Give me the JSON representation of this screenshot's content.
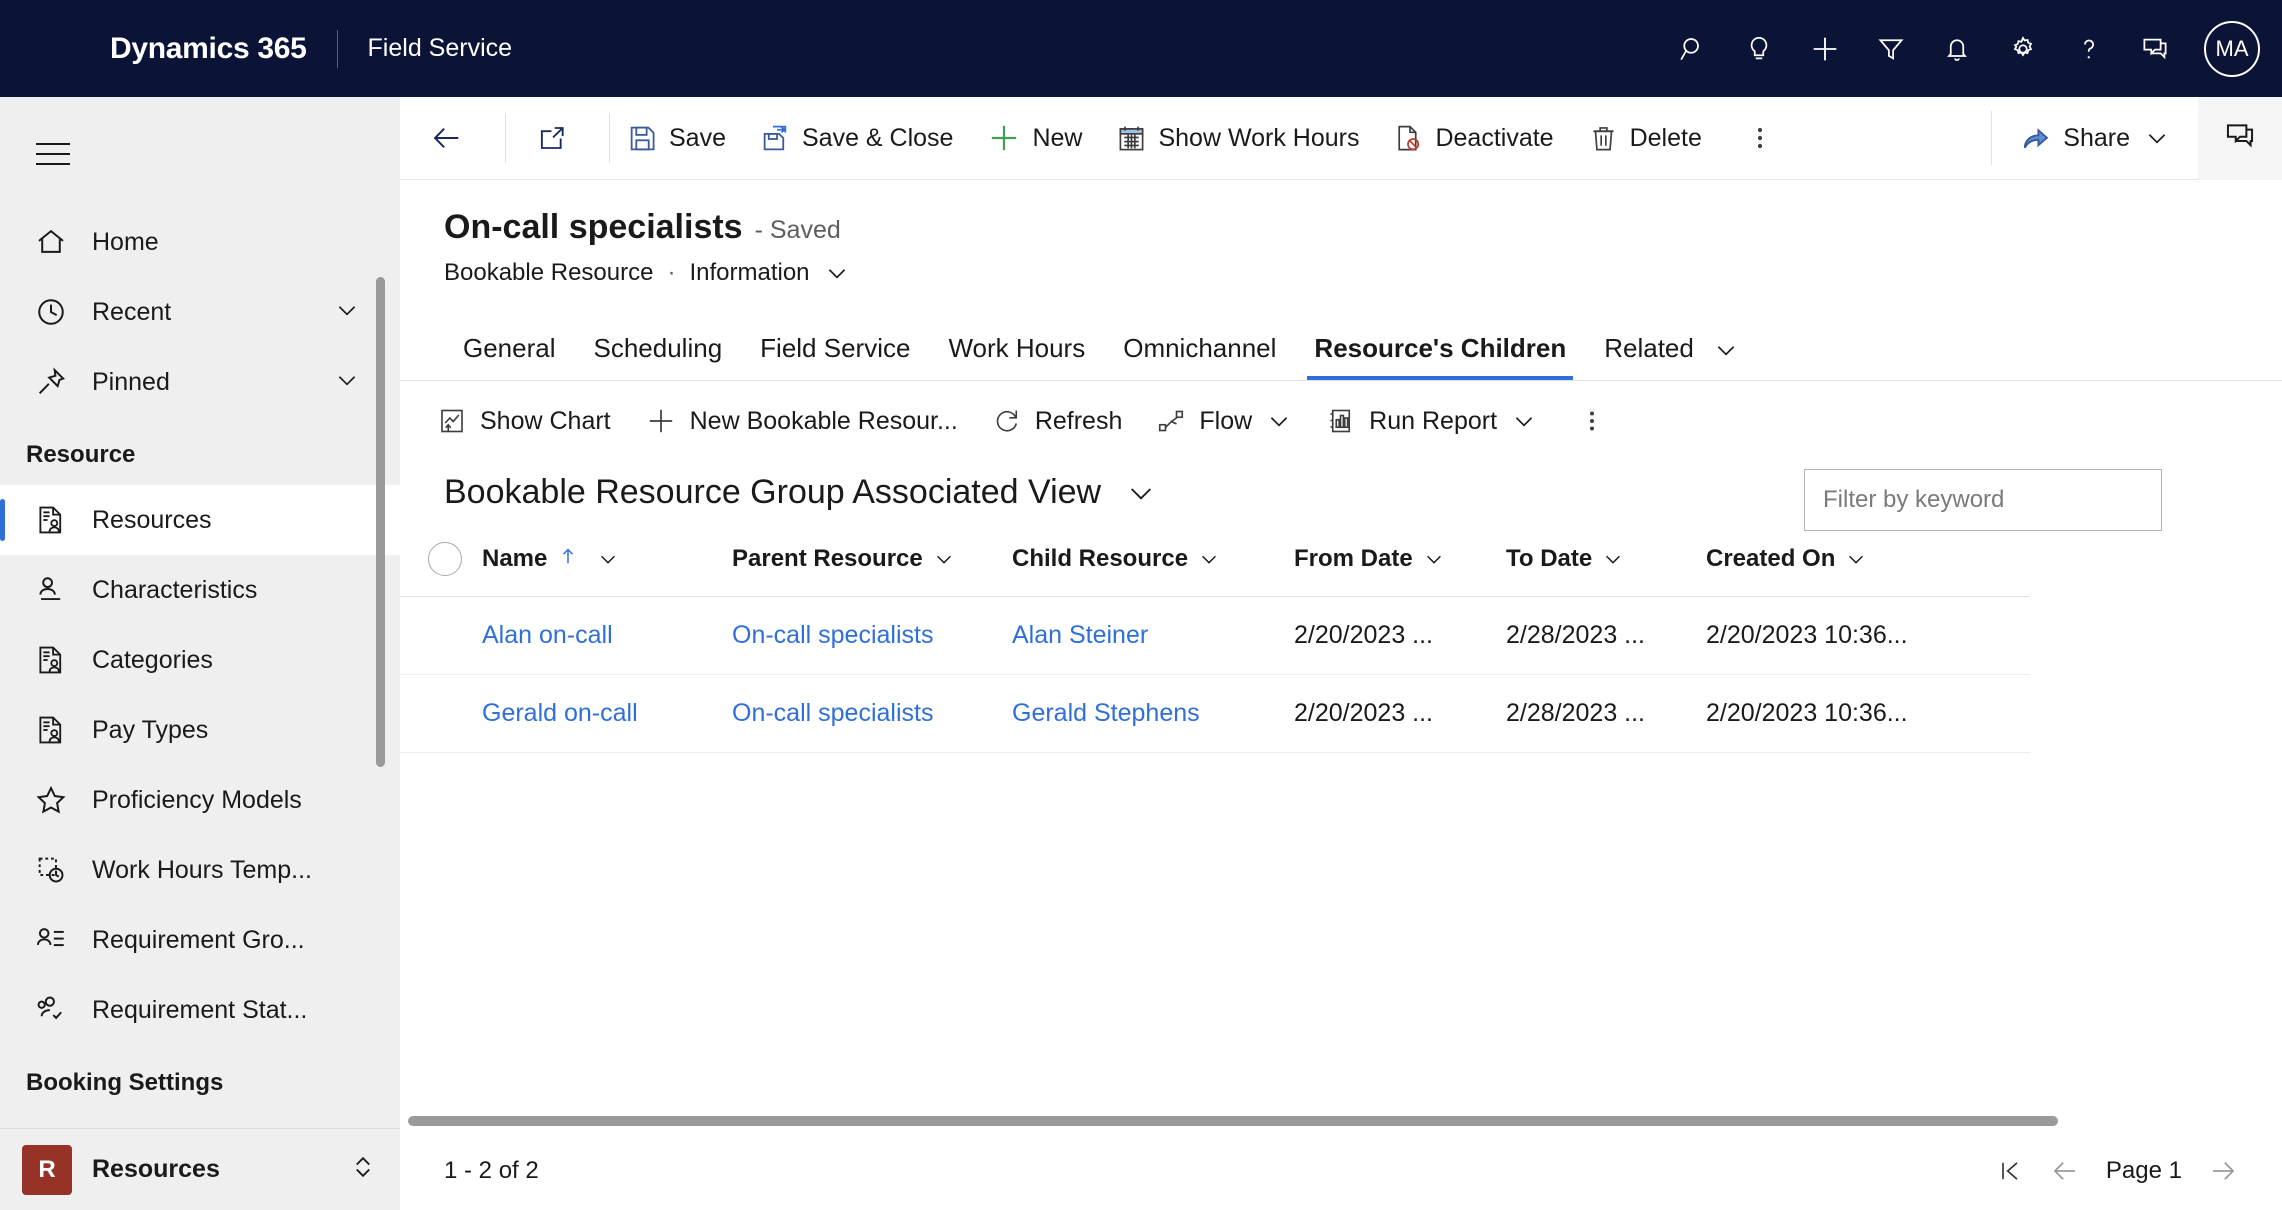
{
  "appbar": {
    "brand": "Dynamics 365",
    "app_name": "Field Service",
    "icons": [
      {
        "name": "search-icon",
        "label": "Search"
      },
      {
        "name": "lightbulb-icon",
        "label": "Insights"
      },
      {
        "name": "plus-icon",
        "label": "Quick create"
      },
      {
        "name": "filter-icon",
        "label": "Filter"
      },
      {
        "name": "bell-icon",
        "label": "Notifications"
      },
      {
        "name": "gear-icon",
        "label": "Settings"
      },
      {
        "name": "question-icon",
        "label": "Help"
      },
      {
        "name": "feedback-icon",
        "label": "Feedback"
      }
    ],
    "avatar_initials": "MA"
  },
  "sidebar": {
    "top_items": [
      {
        "label": "Home",
        "icon": "home-icon",
        "chevron": false,
        "selected": false
      },
      {
        "label": "Recent",
        "icon": "clock-icon",
        "chevron": true,
        "selected": false
      },
      {
        "label": "Pinned",
        "icon": "pin-icon",
        "chevron": true,
        "selected": false
      }
    ],
    "group_resource": "Resource",
    "resource_items": [
      {
        "label": "Resources",
        "icon": "resource-icon",
        "selected": true
      },
      {
        "label": "Characteristics",
        "icon": "person-line-icon",
        "selected": false
      },
      {
        "label": "Categories",
        "icon": "resource-icon",
        "selected": false
      },
      {
        "label": "Pay Types",
        "icon": "resource-icon",
        "selected": false
      },
      {
        "label": "Proficiency Models",
        "icon": "star-icon",
        "selected": false
      },
      {
        "label": "Work Hours Temp...",
        "icon": "work-hours-icon",
        "selected": false
      },
      {
        "label": "Requirement Gro...",
        "icon": "person-list-icon",
        "selected": false
      },
      {
        "label": "Requirement Stat...",
        "icon": "people-check-icon",
        "selected": false
      }
    ],
    "group_booking": "Booking Settings",
    "area_switcher": {
      "badge": "R",
      "label": "Resources"
    }
  },
  "commandbar": {
    "back_label": "Back",
    "popout_label": "Open in new window",
    "buttons": [
      {
        "label": "Save",
        "icon": "save-icon"
      },
      {
        "label": "Save & Close",
        "icon": "save-close-icon"
      },
      {
        "label": "New",
        "icon": "plus-icon"
      },
      {
        "label": "Show Work Hours",
        "icon": "calendar-icon"
      },
      {
        "label": "Deactivate",
        "icon": "deactivate-icon"
      },
      {
        "label": "Delete",
        "icon": "trash-icon"
      }
    ],
    "overflow_label": "More commands",
    "share_label": "Share",
    "assistant_label": "Assistant"
  },
  "record": {
    "title": "On-call specialists",
    "state": "- Saved",
    "entity": "Bookable Resource",
    "separator": "·",
    "form": "Information"
  },
  "tabs": [
    {
      "label": "General",
      "active": false
    },
    {
      "label": "Scheduling",
      "active": false
    },
    {
      "label": "Field Service",
      "active": false
    },
    {
      "label": "Work Hours",
      "active": false
    },
    {
      "label": "Omnichannel",
      "active": false
    },
    {
      "label": "Resource's Children",
      "active": true
    },
    {
      "label": "Related",
      "active": false,
      "caret": true
    }
  ],
  "subgrid": {
    "commands": [
      {
        "label": "Show Chart",
        "icon": "chart-icon",
        "caret": false
      },
      {
        "label": "New Bookable Resour...",
        "icon": "plus-icon",
        "caret": false
      },
      {
        "label": "Refresh",
        "icon": "refresh-icon",
        "caret": false
      },
      {
        "label": "Flow",
        "icon": "flow-icon",
        "caret": true
      },
      {
        "label": "Run Report",
        "icon": "report-icon",
        "caret": true
      }
    ],
    "overflow_label": "More commands",
    "view_name": "Bookable Resource Group Associated View",
    "filter_placeholder": "Filter by keyword",
    "filter_value": "",
    "columns": [
      {
        "label": "Name",
        "sorted": true,
        "sort_dir": "asc"
      },
      {
        "label": "Parent Resource",
        "sorted": false
      },
      {
        "label": "Child Resource",
        "sorted": false
      },
      {
        "label": "From Date",
        "sorted": false
      },
      {
        "label": "To Date",
        "sorted": false
      },
      {
        "label": "Created On",
        "sorted": false
      }
    ],
    "rows": [
      {
        "name": "Alan on-call",
        "parent_resource": "On-call specialists",
        "child_resource": "Alan Steiner",
        "from_date": "2/20/2023 ...",
        "to_date": "2/28/2023 ...",
        "created_on": "2/20/2023 10:36..."
      },
      {
        "name": "Gerald on-call",
        "parent_resource": "On-call specialists",
        "child_resource": "Gerald Stephens",
        "from_date": "2/20/2023 ...",
        "to_date": "2/28/2023 ...",
        "created_on": "2/20/2023 10:36..."
      }
    ],
    "record_count": "1 - 2 of 2",
    "page_label": "Page 1"
  }
}
